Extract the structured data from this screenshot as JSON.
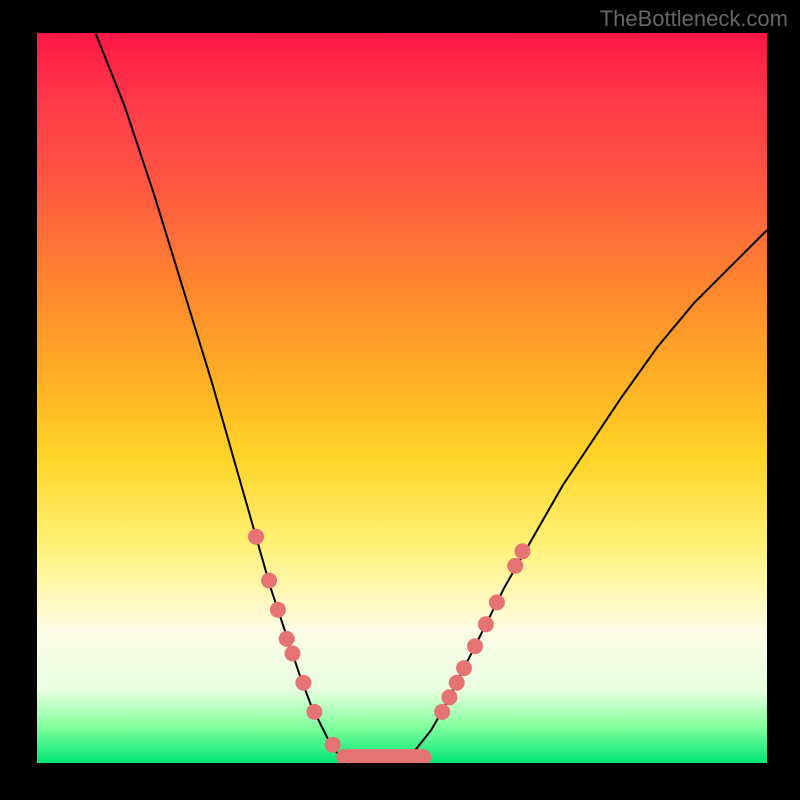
{
  "watermark": "TheBottleneck.com",
  "chart_data": {
    "type": "line",
    "title": "",
    "xlabel": "",
    "ylabel": "",
    "xlim": [
      0,
      100
    ],
    "ylim": [
      0,
      100
    ],
    "series": [
      {
        "name": "curve-left",
        "x": [
          8,
          12,
          16,
          20,
          24,
          28,
          30,
          32,
          34,
          36,
          37.5,
          39,
          40,
          41,
          42,
          43
        ],
        "y": [
          100,
          90,
          78,
          65,
          52,
          38,
          31,
          24,
          18,
          12,
          8,
          5,
          3,
          1.5,
          0.8,
          0.3
        ]
      },
      {
        "name": "curve-right",
        "x": [
          50,
          51,
          52,
          54,
          56,
          58,
          60,
          64,
          68,
          72,
          76,
          80,
          85,
          90,
          95,
          100
        ],
        "y": [
          0.3,
          1,
          2,
          4.5,
          8,
          12,
          16,
          24,
          31,
          38,
          44,
          50,
          57,
          63,
          68,
          73
        ]
      },
      {
        "name": "flat-bottom",
        "x": [
          43,
          45,
          47,
          49,
          50
        ],
        "y": [
          0.3,
          0.2,
          0.2,
          0.2,
          0.3
        ]
      }
    ],
    "markers_left": [
      {
        "x": 30,
        "y": 31
      },
      {
        "x": 31.8,
        "y": 25
      },
      {
        "x": 33,
        "y": 21
      },
      {
        "x": 34.2,
        "y": 17
      },
      {
        "x": 35,
        "y": 15
      },
      {
        "x": 36.5,
        "y": 11
      },
      {
        "x": 38,
        "y": 7
      },
      {
        "x": 40.5,
        "y": 2.5
      }
    ],
    "markers_right": [
      {
        "x": 55.5,
        "y": 7
      },
      {
        "x": 56.5,
        "y": 9
      },
      {
        "x": 57.5,
        "y": 11
      },
      {
        "x": 58.5,
        "y": 13
      },
      {
        "x": 60,
        "y": 16
      },
      {
        "x": 61.5,
        "y": 19
      },
      {
        "x": 63,
        "y": 22
      },
      {
        "x": 65.5,
        "y": 27
      },
      {
        "x": 66.5,
        "y": 29
      }
    ],
    "bottom_bar": {
      "x_start": 41,
      "x_end": 54,
      "y": 0.8,
      "thickness": 2.2
    },
    "palette": {
      "curve": "#000000",
      "marker": "#e57373",
      "bar": "#e57373"
    }
  }
}
